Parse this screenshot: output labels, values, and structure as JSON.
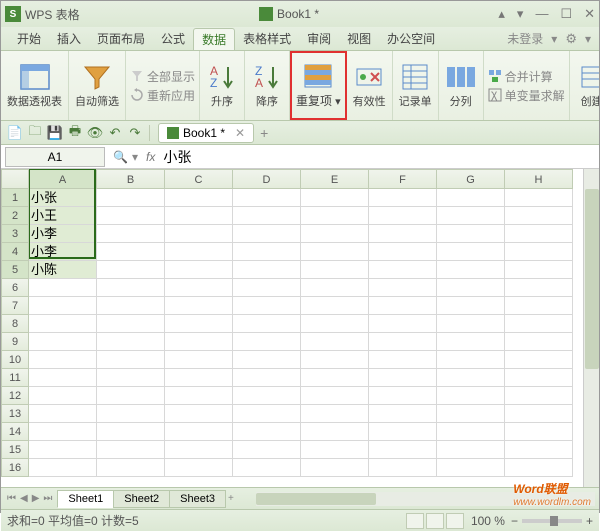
{
  "app": {
    "logo_letter": "S",
    "name": "WPS 表格",
    "doc": "Book1 *"
  },
  "win": {
    "min": "▴",
    "down": "▾",
    "restore": "—",
    "max": "☐",
    "close": "✕"
  },
  "menu": {
    "tabs": [
      "开始",
      "插入",
      "页面布局",
      "公式",
      "数据",
      "表格样式",
      "审阅",
      "视图",
      "办公空间"
    ],
    "active": 4,
    "login": "未登录",
    "gear": "⚙",
    "drop": "▾"
  },
  "ribbon": {
    "pivot": "数据透视表",
    "autofilter": "自动筛选",
    "showall": "全部显示",
    "reapply": "重新应用",
    "sort_asc": "升序",
    "sort_desc": "降序",
    "dup": "重复项",
    "validity": "有效性",
    "form": "记录单",
    "split": "分列",
    "consolidate": "合并计算",
    "solver": "单变量求解",
    "create": "创建"
  },
  "qat": {
    "btns": [
      "📄",
      "🗀",
      "💾",
      "🖶",
      "👁",
      "↶",
      "↷"
    ],
    "doctab": "Book1 *",
    "close": "✕",
    "plus": "+"
  },
  "formula": {
    "cell": "A1",
    "search": "🔍",
    "drop": "▾",
    "fx": "fx",
    "value": "小张"
  },
  "grid": {
    "cols": [
      "A",
      "B",
      "C",
      "D",
      "E",
      "F",
      "G",
      "H"
    ],
    "rows": 16,
    "data": {
      "A1": "小张",
      "A2": "小王",
      "A3": "小李",
      "A4": "小李",
      "A5": "小陈"
    },
    "sel_rows": [
      1,
      2,
      3,
      4,
      5
    ],
    "sel_col": "A"
  },
  "sheets": {
    "tabs": [
      "Sheet1",
      "Sheet2",
      "Sheet3"
    ],
    "active": 0,
    "plus": "+"
  },
  "status": {
    "text": "求和=0  平均值=0  计数=5",
    "zoom": "100 %",
    "minus": "−",
    "plus": "+"
  },
  "watermark": {
    "main": "Word联盟",
    "sub": "www.wordlm.com"
  }
}
